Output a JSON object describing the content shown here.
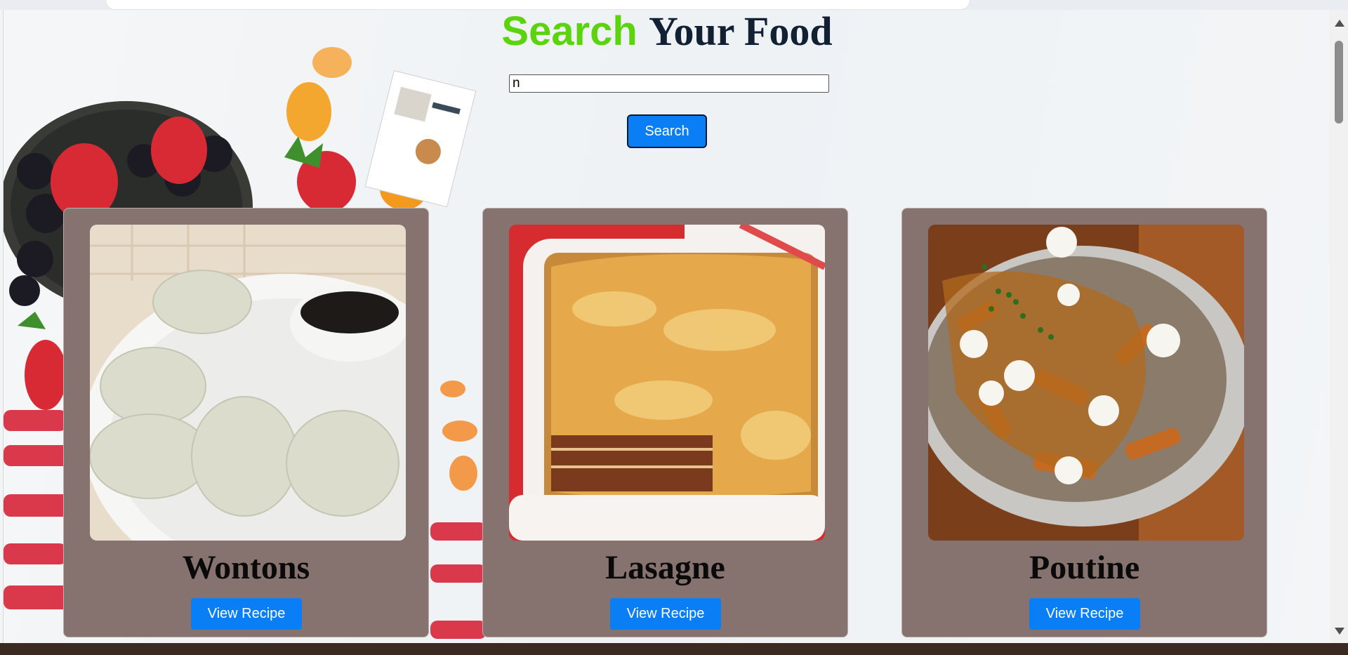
{
  "header": {
    "title_part1": "Search",
    "title_part2": "Your Food"
  },
  "search": {
    "value": "n",
    "button_label": "Search"
  },
  "recipes": [
    {
      "name": "Wontons",
      "button_label": "View Recipe"
    },
    {
      "name": "Lasagne",
      "button_label": "View Recipe"
    },
    {
      "name": "Poutine",
      "button_label": "View Recipe"
    }
  ],
  "colors": {
    "title_green": "#5bd40e",
    "title_dark": "#112032",
    "button_blue": "#0a7ff5",
    "card_background": "#86726f"
  }
}
